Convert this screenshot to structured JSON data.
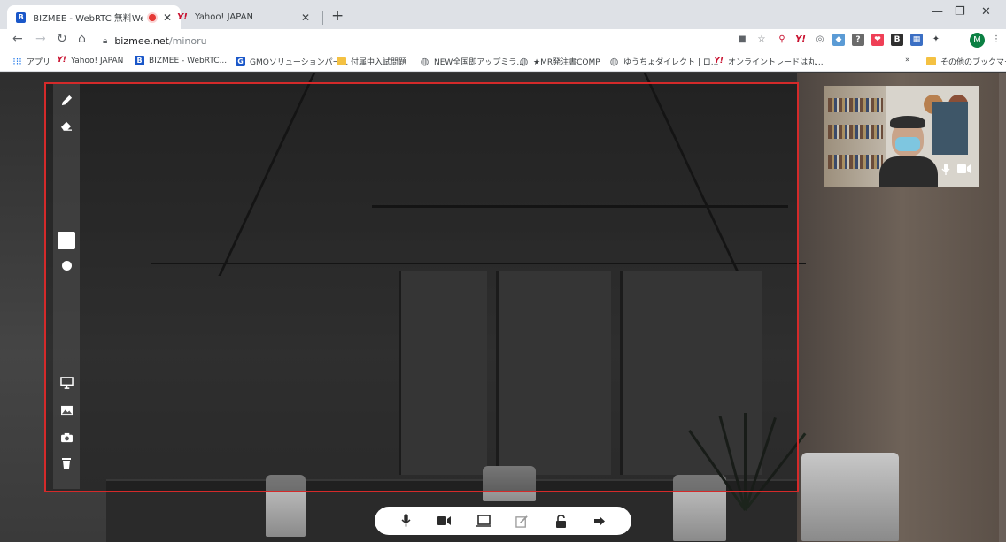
{
  "browser": {
    "tabs": [
      {
        "label": "BIZMEE - WebRTC 無料Web",
        "favicon": "bizmee-favicon",
        "recording": true
      },
      {
        "label": "Yahoo! JAPAN",
        "favicon": "yahoo-favicon",
        "recording": false
      }
    ],
    "close_glyph": "✕",
    "new_tab_glyph": "+",
    "window_controls": {
      "minimize": "—",
      "restore": "❐",
      "close": "✕"
    },
    "url_host": "bizmee.net",
    "url_path": "/minoru",
    "profile_initial": "M",
    "extension_icons": [
      "video-camera-icon",
      "star-icon",
      "search-icon",
      "yahoo-icon",
      "extension-icon",
      "extension-icon",
      "help-icon",
      "pocket-icon",
      "hatena-bookmark-icon",
      "extension-icon",
      "puzzle-icon"
    ],
    "bookmarks": [
      {
        "label": "アプリ",
        "icon": "apps-icon"
      },
      {
        "label": "Yahoo! JAPAN",
        "icon": "yahoo-icon"
      },
      {
        "label": "BIZMEE - WebRTC...",
        "icon": "bizmee-icon"
      },
      {
        "label": "GMOソリューションパー...",
        "icon": "gmo-icon"
      },
      {
        "label": "付属中入試問題",
        "icon": "folder-icon"
      },
      {
        "label": "NEW全国即アップミラ...",
        "icon": "globe-icon"
      },
      {
        "label": "★MR発注書COMP",
        "icon": "globe-icon"
      },
      {
        "label": "ゆうちょダイレクト | ロ...",
        "icon": "globe-icon"
      },
      {
        "label": "オンライントレードは丸...",
        "icon": "yahoo-icon"
      },
      {
        "label": "»",
        "icon": ""
      },
      {
        "label": "その他のブックマーク",
        "icon": "folder-icon"
      }
    ]
  },
  "meeting": {
    "border_color": "#d42a2a",
    "side_tools": [
      "pencil-icon",
      "eraser-icon",
      "color-swatch-white",
      "brush-size-dot",
      "monitor-icon",
      "image-icon",
      "camera-icon",
      "trash-icon"
    ],
    "bottom_controls": [
      "microphone-icon",
      "video-camera-icon",
      "screen-share-icon",
      "whiteboard-edit-icon",
      "unlock-icon",
      "leave-icon"
    ],
    "self_view": {
      "mic_icon": "microphone-icon",
      "cam_icon": "video-camera-icon"
    }
  }
}
